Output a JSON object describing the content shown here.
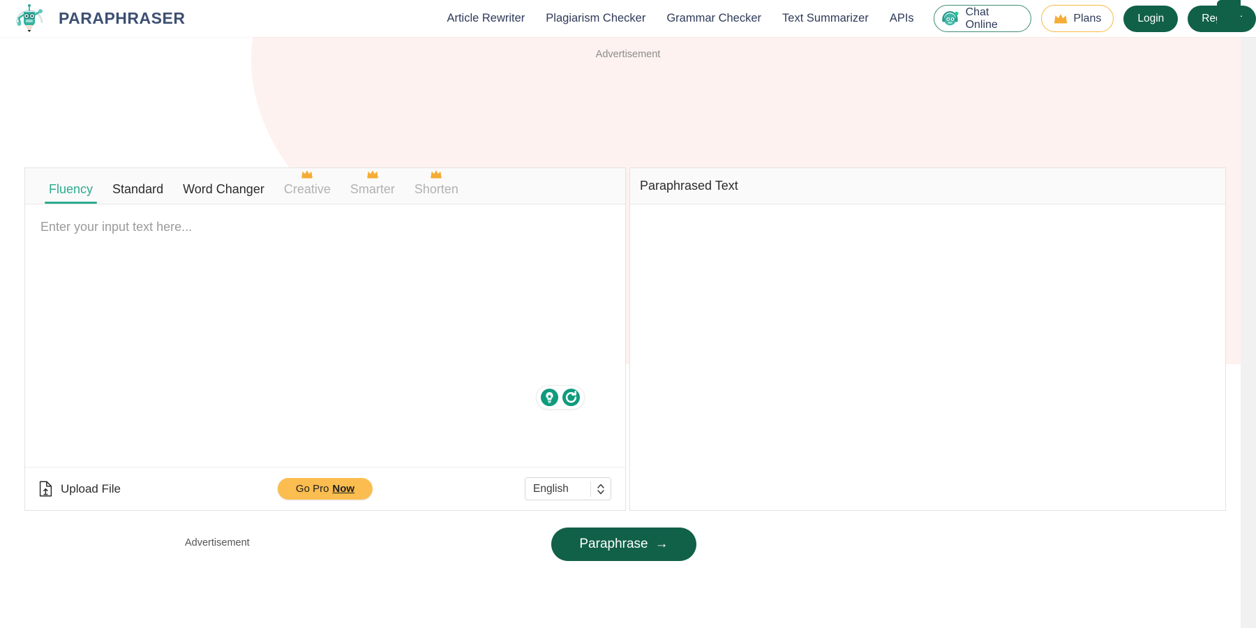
{
  "header": {
    "brand_name": "PARAPHRASER",
    "logo_icon": "robot-pencil-mascot-icon",
    "nav_links": [
      "Article Rewriter",
      "Plagiarism Checker",
      "Grammar Checker",
      "Text Summarizer",
      "APIs"
    ],
    "chat": {
      "label": "Chat Online",
      "icon": "chat-avatar-icon"
    },
    "plans": {
      "label": "Plans",
      "icon": "crown-icon"
    },
    "login_label": "Login",
    "register_label": "Register"
  },
  "ads": {
    "top_label": "Advertisement",
    "bottom_label": "Advertisement"
  },
  "input_panel": {
    "tabs": [
      {
        "label": "Fluency",
        "active": true,
        "locked": false
      },
      {
        "label": "Standard",
        "active": false,
        "locked": false
      },
      {
        "label": "Word Changer",
        "active": false,
        "locked": false
      },
      {
        "label": "Creative",
        "active": false,
        "locked": true
      },
      {
        "label": "Smarter",
        "active": false,
        "locked": true
      },
      {
        "label": "Shorten",
        "active": false,
        "locked": true
      }
    ],
    "placeholder": "Enter your input text here...",
    "editor_value": "",
    "tools": [
      {
        "name": "lightbulb-icon"
      },
      {
        "name": "refresh-icon"
      }
    ],
    "upload_label": "Upload File",
    "upload_icon": "file-upload-icon",
    "gopro_prefix": "Go Pro",
    "gopro_emphasis": "Now",
    "language_value": "English",
    "language_options": [
      "English"
    ]
  },
  "output_panel": {
    "title": "Paraphrased Text",
    "content": ""
  },
  "actions": {
    "paraphrase_label": "Paraphrase",
    "paraphrase_arrow": "→"
  },
  "colors": {
    "brand_navy": "#3d4f72",
    "primary_green": "#116048",
    "accent_teal": "#2cab8e",
    "gold": "#fbbd4f",
    "blob_pink": "#fdf2ef"
  }
}
